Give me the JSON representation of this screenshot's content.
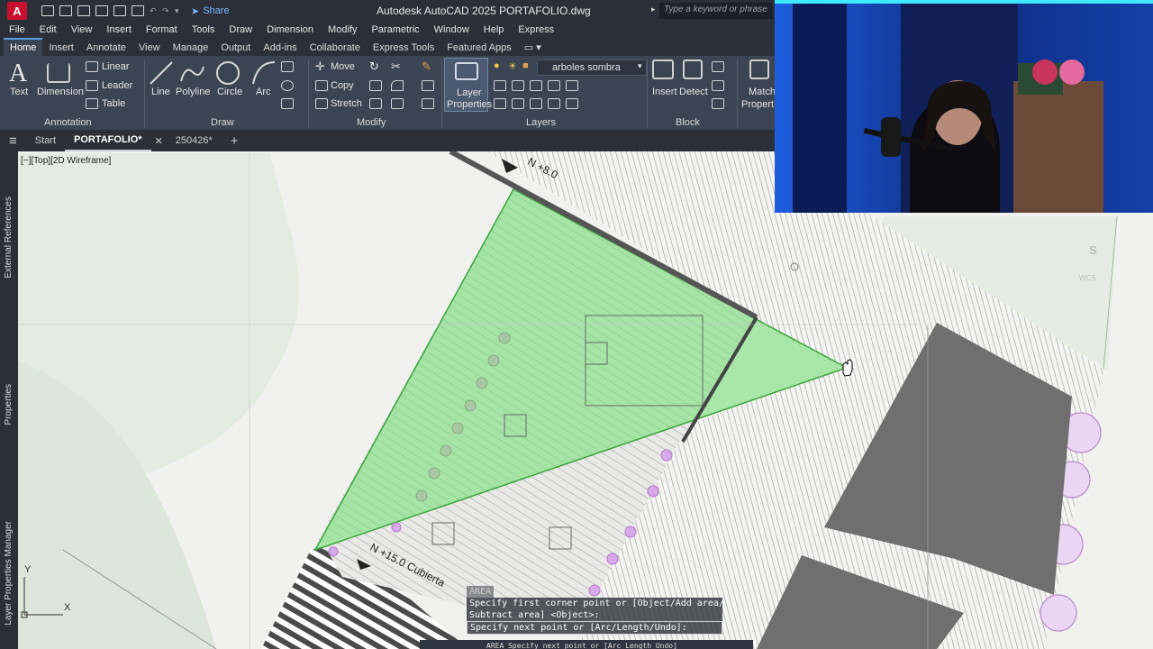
{
  "titlebar": {
    "logo_letter": "A",
    "share_label": "Share",
    "title": "Autodesk AutoCAD 2025   PORTAFOLIO.dwg",
    "search_placeholder": "Type a keyword or phrase"
  },
  "menu": [
    "File",
    "Edit",
    "View",
    "Insert",
    "Format",
    "Tools",
    "Draw",
    "Dimension",
    "Modify",
    "Parametric",
    "Window",
    "Help",
    "Express"
  ],
  "ribbon_tabs": [
    "Home",
    "Insert",
    "Annotate",
    "View",
    "Manage",
    "Output",
    "Add-ins",
    "Collaborate",
    "Express Tools",
    "Featured Apps"
  ],
  "ribbon": {
    "annotation": {
      "title": "Annotation",
      "text": "Text",
      "dimension": "Dimension",
      "linear": "Linear",
      "leader": "Leader",
      "table": "Table"
    },
    "draw": {
      "title": "Draw",
      "line": "Line",
      "polyline": "Polyline",
      "circle": "Circle",
      "arc": "Arc"
    },
    "modify": {
      "title": "Modify",
      "move": "Move",
      "copy": "Copy",
      "stretch": "Stretch"
    },
    "layers": {
      "title": "Layers",
      "layer_properties_1": "Layer",
      "layer_properties_2": "Properties",
      "current_layer": "arboles sombra"
    },
    "block": {
      "title": "Block",
      "insert": "Insert",
      "detect": "Detect"
    },
    "match": {
      "line1": "Match",
      "line2": "Propert"
    }
  },
  "file_tabs": {
    "start": "Start",
    "portafolio": "PORTAFOLIO*",
    "other": "250426*"
  },
  "left_strip": [
    "External References",
    "Properties",
    "Layer Properties Manager"
  ],
  "viewport": {
    "label": "[−][Top][2D Wireframe]",
    "level_top": "N +8.0",
    "level_bottom": "N +15.0 Cubierta",
    "compass_s": "S",
    "wcs": "WCS",
    "ucs_x": "X",
    "ucs_y": "Y"
  },
  "command": {
    "history_tag": "AREA",
    "line1": "Specify first corner point or [Object/Add area/",
    "line2": "Subtract area] <Object>:",
    "line3": "Specify next point or [Arc/Length/Undo]:",
    "prompt": "AREA Specify next point or [Arc Length Undo]"
  },
  "colors": {
    "selection_fill": "#7de07d",
    "selection_edge": "#3aa53a",
    "building": "#6f6f6f",
    "ribbon_bg": "#3b4453",
    "title_bg": "#2b2f38",
    "canvas_bg": "#f1f1ef"
  }
}
